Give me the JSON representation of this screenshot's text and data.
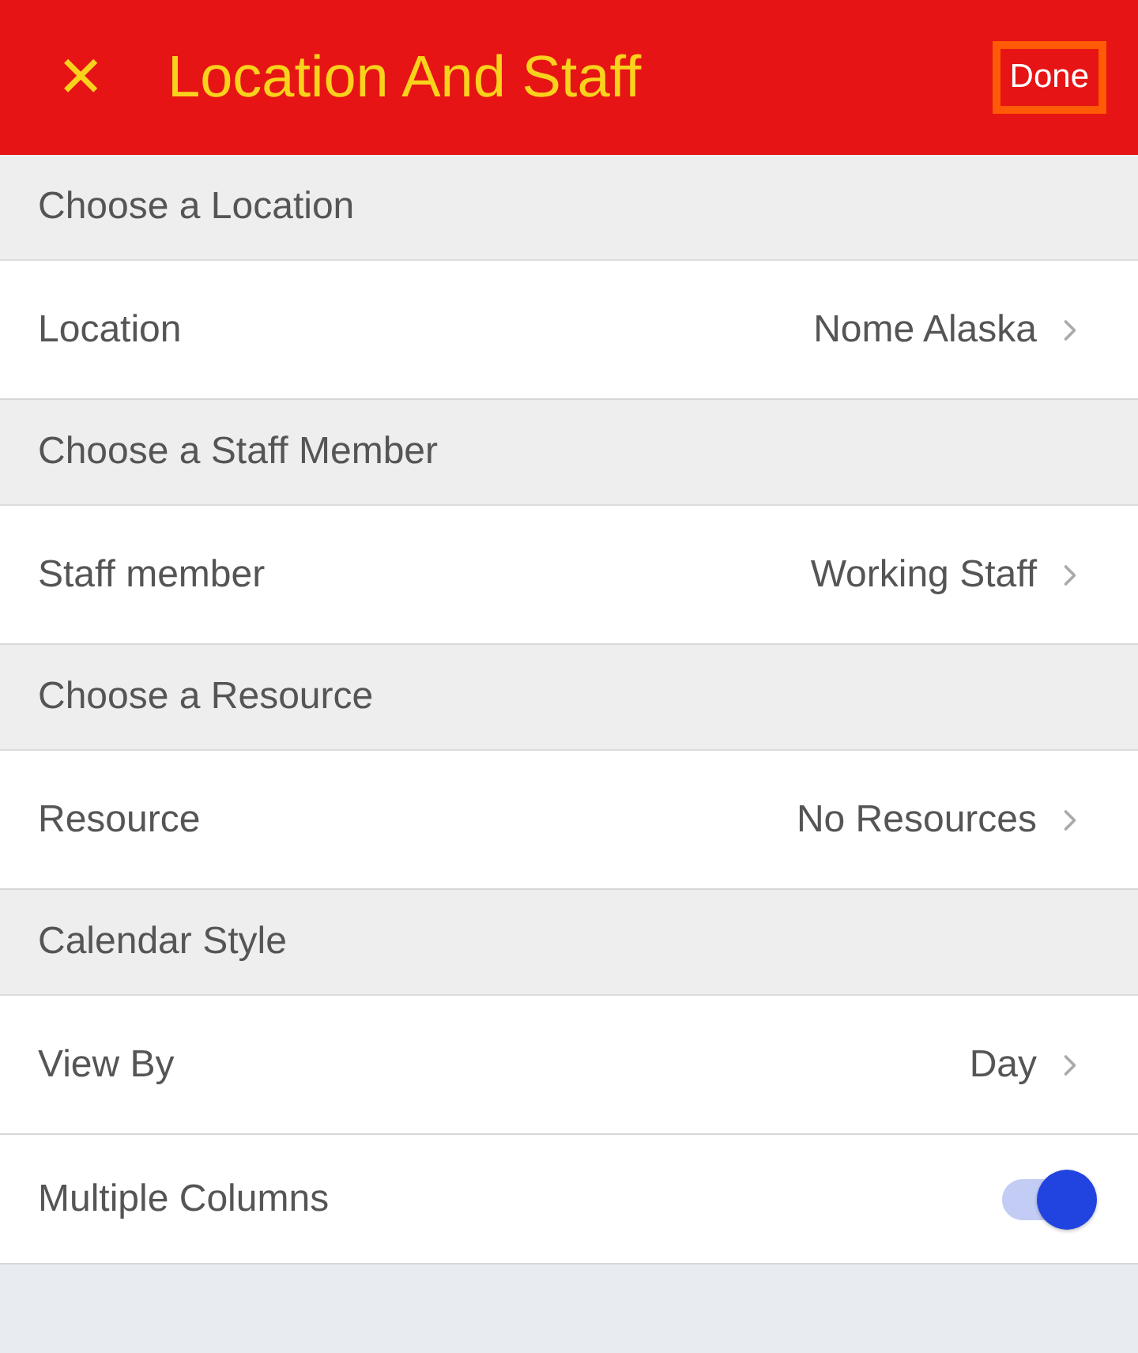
{
  "header": {
    "close_glyph": "✕",
    "title": "Location And Staff",
    "done": {
      "label": "Done",
      "highlighted": true
    }
  },
  "sections": [
    {
      "title": "Choose a Location",
      "rows": [
        {
          "kind": "link",
          "label": "Location",
          "value": "Nome Alaska"
        }
      ]
    },
    {
      "title": "Choose a Staff Member",
      "rows": [
        {
          "kind": "link",
          "label": "Staff member",
          "value": "Working Staff"
        }
      ]
    },
    {
      "title": "Choose a Resource",
      "rows": [
        {
          "kind": "link",
          "label": "Resource",
          "value": "No Resources"
        }
      ]
    },
    {
      "title": "Calendar Style",
      "rows": [
        {
          "kind": "link",
          "label": "View By",
          "value": "Day"
        },
        {
          "kind": "toggle",
          "label": "Multiple Columns",
          "on": true
        }
      ]
    }
  ]
}
